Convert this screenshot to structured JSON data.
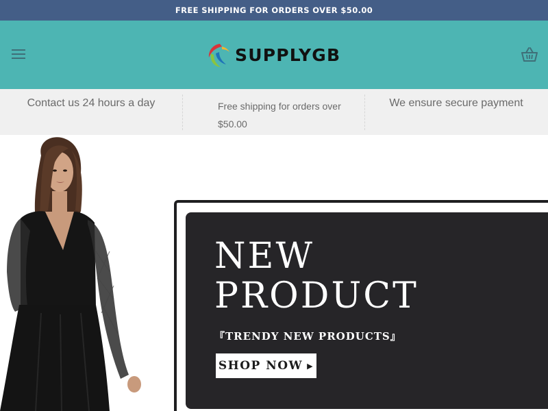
{
  "promo": {
    "text": "FREE SHIPPING FOR ORDERS OVER $50.00"
  },
  "header": {
    "brand": "SUPPLYGB",
    "menu_icon": "hamburger-menu-icon",
    "cart_icon": "shopping-basket-icon",
    "background_color": "#4db5b3"
  },
  "features": [
    {
      "text": "Contact us 24 hours a day"
    },
    {
      "text": "Free shipping for orders over $50.00"
    },
    {
      "text": "We ensure secure payment"
    }
  ],
  "hero": {
    "title": "NEW\nPRODUCT",
    "subtitle": "『TRENDY NEW PRODUCTS』",
    "cta_label": "SHOP NOW",
    "cta_icon": "play-triangle-icon"
  },
  "colors": {
    "promo_bar": "#445e87",
    "header": "#4db5b3",
    "feature_strip": "#f0f0f0",
    "banner_dark": "#262528"
  }
}
